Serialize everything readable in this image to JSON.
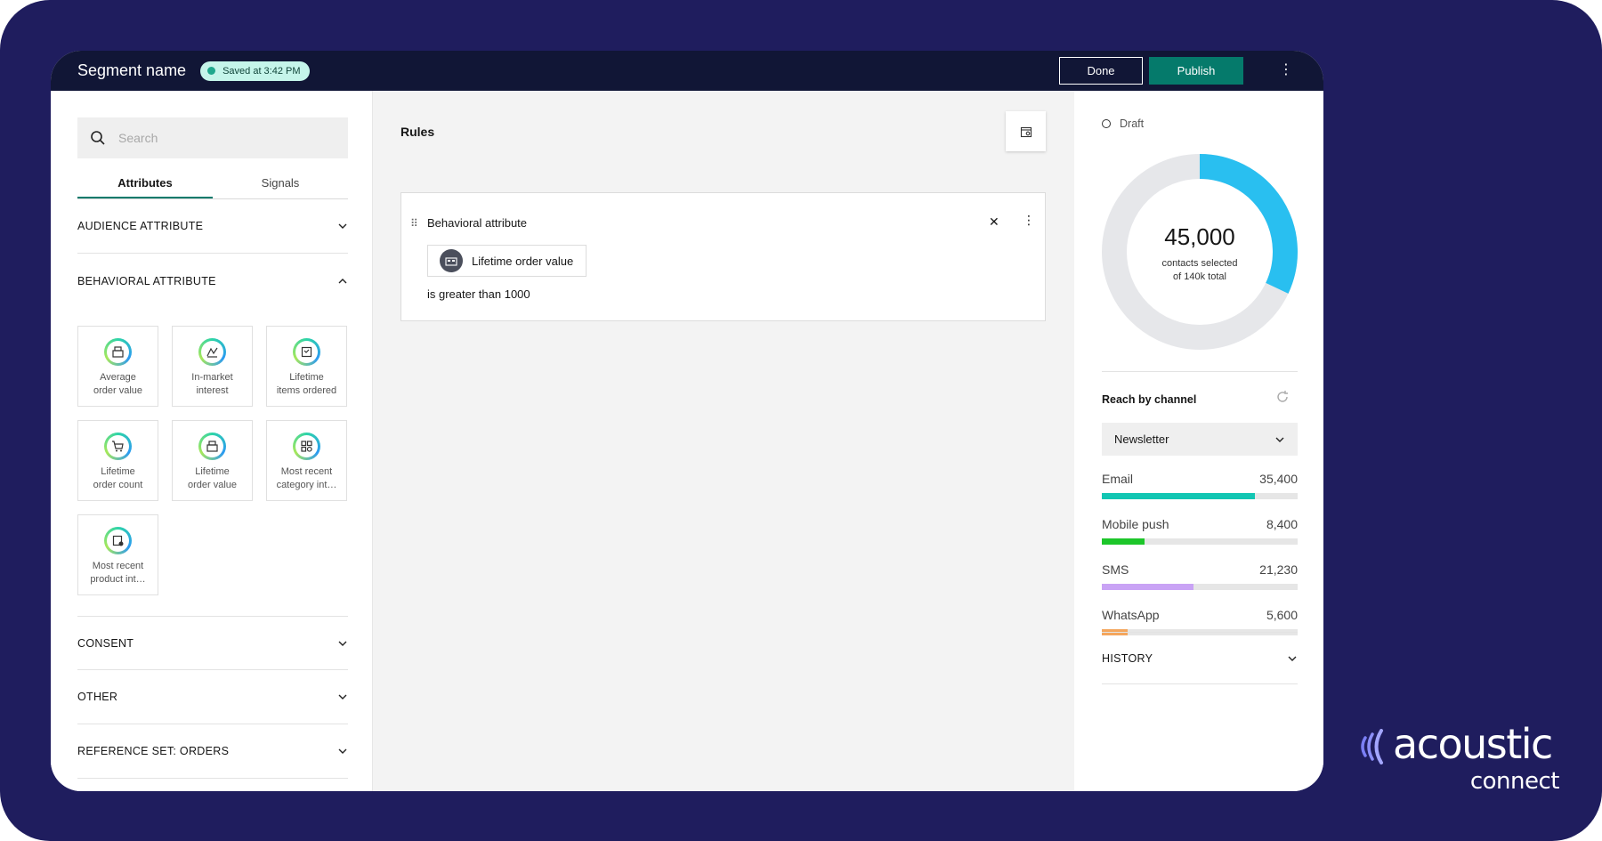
{
  "header": {
    "title": "Segment name",
    "saved_status": "Saved at 3:42 PM",
    "done_label": "Done",
    "publish_label": "Publish"
  },
  "left": {
    "search_placeholder": "Search",
    "tabs": [
      {
        "label": "Attributes",
        "active": true
      },
      {
        "label": "Signals",
        "active": false
      }
    ],
    "sections": [
      {
        "label": "AUDIENCE ATTRIBUTE",
        "expanded": false
      },
      {
        "label": "BEHAVIORAL ATTRIBUTE",
        "expanded": true
      },
      {
        "label": "CONSENT",
        "expanded": false
      },
      {
        "label": "OTHER",
        "expanded": false
      },
      {
        "label": "REFERENCE SET: ORDERS",
        "expanded": false
      }
    ],
    "tiles": [
      {
        "line1": "Average",
        "line2": "order value",
        "icon": "register-icon"
      },
      {
        "line1": "In-market",
        "line2": "interest",
        "icon": "chart-icon"
      },
      {
        "line1": "Lifetime",
        "line2": "items ordered",
        "icon": "box-icon"
      },
      {
        "line1": "Lifetime",
        "line2": "order count",
        "icon": "cart-icon"
      },
      {
        "line1": "Lifetime",
        "line2": "order value",
        "icon": "register-icon"
      },
      {
        "line1": "Most recent",
        "line2": "category int…",
        "icon": "category-icon"
      },
      {
        "line1": "Most recent",
        "line2": "product int…",
        "icon": "product-icon"
      }
    ]
  },
  "center": {
    "title": "Rules",
    "rule": {
      "category": "Behavioral attribute",
      "attribute": "Lifetime order value",
      "condition": "is greater than 1000"
    }
  },
  "right": {
    "status": "Draft",
    "donut": {
      "value": "45,000",
      "sub1": "contacts selected",
      "sub2": "of 140k total",
      "fraction": 0.32,
      "color": "#29bff0"
    },
    "reach_title": "Reach by channel",
    "channel_select": "Newsletter",
    "channels": [
      {
        "name": "Email",
        "value": "35,400",
        "fraction": 0.78,
        "color": "#12c6b3"
      },
      {
        "name": "Mobile push",
        "value": "8,400",
        "fraction": 0.22,
        "color": "#1dc62a"
      },
      {
        "name": "SMS",
        "value": "21,230",
        "fraction": 0.47,
        "color": "#c9a3f5"
      },
      {
        "name": "WhatsApp",
        "value": "5,600",
        "fraction": 0.13,
        "color": "#f4a65d"
      }
    ],
    "history_label": "HISTORY"
  },
  "brand": {
    "word": "acoustic",
    "sub": "connect"
  }
}
